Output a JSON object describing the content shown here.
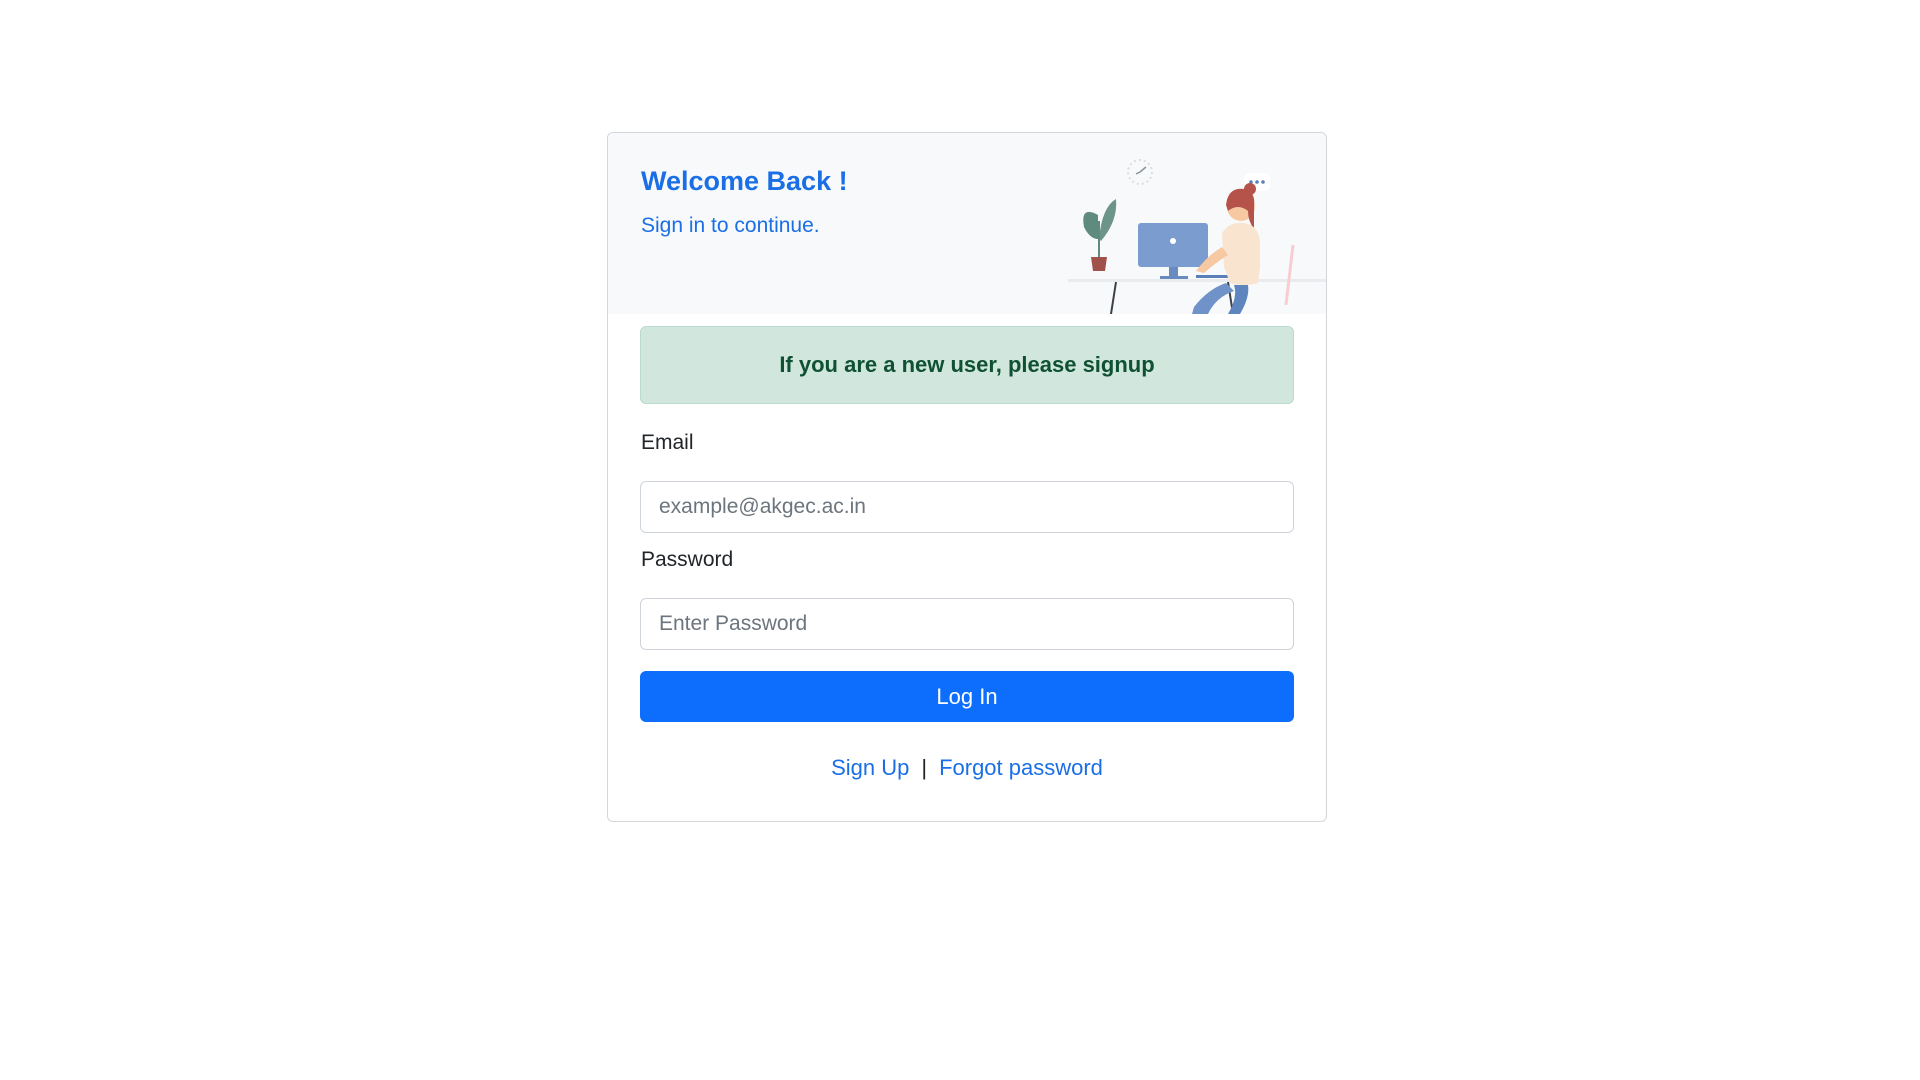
{
  "header": {
    "title": "Welcome Back !",
    "subtitle": "Sign in to continue.",
    "illustration": "person-at-desk-illustration"
  },
  "alert": {
    "text": "If you are a new user, please signup"
  },
  "form": {
    "email_label": "Email",
    "email_placeholder": "example@akgec.ac.in",
    "email_value": "",
    "password_label": "Password",
    "password_placeholder": "Enter Password",
    "password_value": "",
    "submit_label": "Log In"
  },
  "footer": {
    "signup_link": "Sign Up",
    "separator": "|",
    "forgot_link": "Forgot password"
  },
  "colors": {
    "primary": "#0d6efd",
    "title_blue": "#1a6fe6",
    "alert_bg": "#d1e7dd",
    "alert_text": "#0f5132",
    "header_bg": "#f8f9fa"
  }
}
